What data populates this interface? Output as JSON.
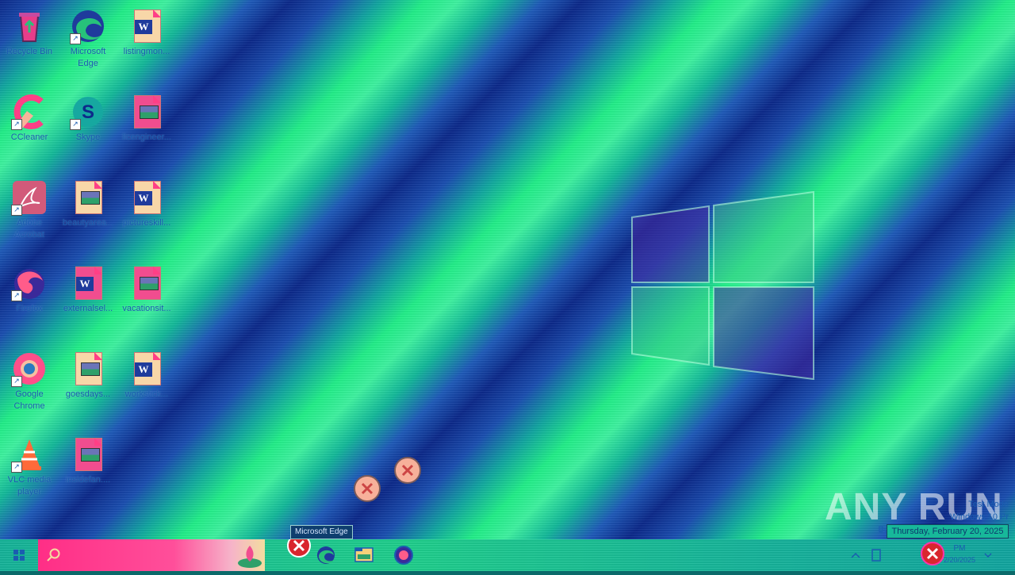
{
  "desktop": {
    "icons": [
      {
        "label": "Recycle Bin",
        "icon": "recycle-bin-icon"
      },
      {
        "label": "Microsoft Edge",
        "icon": "edge-icon"
      },
      {
        "label": "listingmon...",
        "icon": "word-doc-icon"
      },
      {
        "label": "CCleaner",
        "icon": "ccleaner-icon"
      },
      {
        "label": "Skype",
        "icon": "skype-icon"
      },
      {
        "label": "llcengineer...",
        "icon": "image-file-icon"
      },
      {
        "label": "Adobe Acrobat",
        "icon": "acrobat-icon"
      },
      {
        "label": "beautyarea...",
        "icon": "image-file-icon"
      },
      {
        "label": "pictureskill...",
        "icon": "word-doc-icon"
      },
      {
        "label": "Firefox",
        "icon": "firefox-icon"
      },
      {
        "label": "externalsel...",
        "icon": "word-doc-icon"
      },
      {
        "label": "vacationsit...",
        "icon": "image-file-icon"
      },
      {
        "label": "Google Chrome",
        "icon": "chrome-icon"
      },
      {
        "label": "goesdays...",
        "icon": "image-file-icon"
      },
      {
        "label": "workstick...",
        "icon": "word-doc-icon"
      },
      {
        "label": "VLC media player",
        "icon": "vlc-icon"
      },
      {
        "label": "insidefan....",
        "icon": "image-file-icon"
      }
    ]
  },
  "tooltip": {
    "text": "Microsoft Edge"
  },
  "watermark": {
    "logo": "ANY RUN",
    "line1": "Test Mode",
    "line2": "Windows 10 Pr",
    "line3": "Build"
  },
  "clock": {
    "date_tooltip": "Thursday, February 20, 2025",
    "time": "PM",
    "date": "2/20/2025"
  },
  "taskbar": {
    "start_icon": "windows-start-icon",
    "search_icon": "search-icon",
    "pinned": [
      "error-icon",
      "edge-icon",
      "file-explorer-icon",
      "firefox-icon"
    ]
  },
  "colors": {
    "wallpaper_green": "#22ee88",
    "wallpaper_blue": "#0d2a8a",
    "label_blue": "#1a5db0",
    "search_pink": "#ff2e86"
  }
}
